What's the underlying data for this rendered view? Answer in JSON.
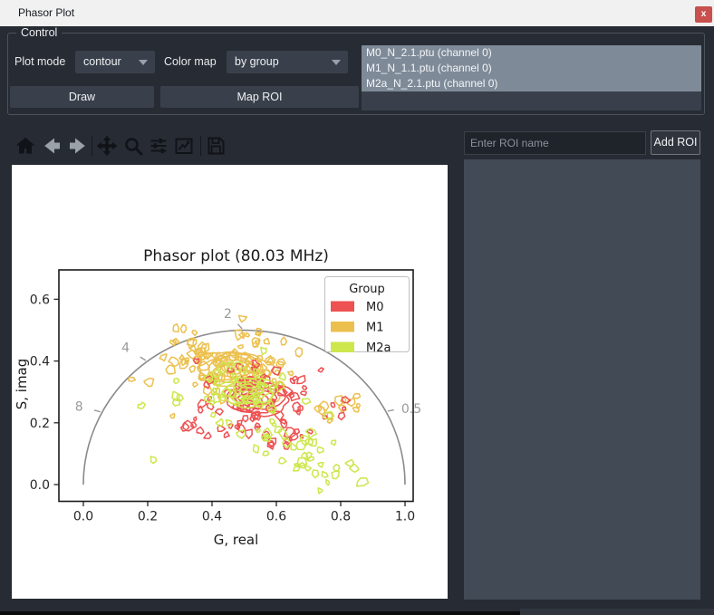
{
  "window": {
    "title": "Phasor Plot",
    "close_label": "x"
  },
  "control": {
    "group_label": "Control",
    "plot_mode_label": "Plot mode",
    "plot_mode_value": "contour",
    "color_map_label": "Color map",
    "color_map_value": "by group",
    "draw_label": "Draw",
    "map_roi_label": "Map ROI",
    "files": [
      "M0_N_2.1.ptu (channel 0)",
      "M1_N_1.1.ptu (channel 0)",
      "M2a_N_2.1.ptu (channel 0)"
    ]
  },
  "toolbar": {
    "icons": [
      {
        "name": "home",
        "enabled": true
      },
      {
        "name": "back",
        "enabled": false
      },
      {
        "name": "forward",
        "enabled": false
      },
      {
        "name": "pan",
        "enabled": true
      },
      {
        "name": "zoom",
        "enabled": true
      },
      {
        "name": "subplots",
        "enabled": true
      },
      {
        "name": "customize",
        "enabled": true
      },
      {
        "name": "save",
        "enabled": true
      }
    ]
  },
  "roi": {
    "input_placeholder": "Enter ROI name",
    "add_button_label": "Add ROI"
  },
  "chart_data": {
    "type": "contour",
    "title": "Phasor plot (80.03 MHz)",
    "frequency_mhz": 80.03,
    "xlabel": "G, real",
    "ylabel": "S, imag",
    "xlim": [
      -0.08,
      1.03
    ],
    "ylim": [
      -0.05,
      0.7
    ],
    "xticks": [
      0.0,
      0.2,
      0.4,
      0.6,
      0.8,
      1.0
    ],
    "yticks": [
      0.0,
      0.2,
      0.4,
      0.6
    ],
    "grid": false,
    "universal_semicircle": {
      "center_g": 0.5,
      "radius": 0.5,
      "color": "#8a8a8a",
      "lifetime_labels": [
        {
          "text": "0.5",
          "tau_ns": 0.5,
          "g": 0.9405,
          "s": 0.2365,
          "offset": [
            10,
            -2
          ],
          "anchor": "start"
        },
        {
          "text": "2",
          "tau_ns": 2,
          "g": 0.4972,
          "s": 0.5,
          "offset": [
            -10,
            -11
          ],
          "anchor": "middle"
        },
        {
          "text": "4",
          "tau_ns": 4,
          "g": 0.1983,
          "s": 0.3989,
          "offset": [
            -14,
            -9
          ],
          "anchor": "middle"
        },
        {
          "text": "8",
          "tau_ns": 8,
          "g": 0.0582,
          "s": 0.2341,
          "offset": [
            -15,
            -4
          ],
          "anchor": "middle"
        }
      ]
    },
    "legend": {
      "title": "Group",
      "position": "upper right",
      "entries": [
        {
          "label": "M0",
          "color": "#ee5152"
        },
        {
          "label": "M1",
          "color": "#ecc04f"
        },
        {
          "label": "M2a",
          "color": "#cde74d"
        }
      ]
    },
    "draw_order": [
      "M1",
      "M0",
      "M2a"
    ],
    "groups": [
      {
        "name": "M0",
        "color": "#ee5152",
        "seed": 7,
        "core": {
          "center": [
            0.545,
            0.275
          ],
          "rx": 0.095,
          "ry": 0.05,
          "ring_scales": [
            0.35,
            0.6,
            0.8,
            1.0
          ],
          "scatter": {
            "sigma": [
              0.09,
              0.05
            ],
            "count": 50
          }
        },
        "satellites": [
          {
            "center": [
              0.42,
              0.2
            ],
            "sigma": [
              0.06,
              0.04
            ],
            "count": 16
          },
          {
            "center": [
              0.62,
              0.16
            ],
            "sigma": [
              0.06,
              0.03
            ],
            "count": 12
          },
          {
            "center": [
              0.52,
              0.33
            ],
            "sigma": [
              0.1,
              0.04
            ],
            "count": 14
          },
          {
            "center": [
              0.78,
              0.24
            ],
            "sigma": [
              0.04,
              0.03
            ],
            "count": 5
          }
        ]
      },
      {
        "name": "M1",
        "color": "#ecc04f",
        "seed": 13,
        "core": {
          "center": [
            0.465,
            0.375
          ],
          "rx": 0.115,
          "ry": 0.055,
          "ring_scales": [
            0.3,
            0.5,
            0.7,
            0.85,
            1.0
          ],
          "scatter": {
            "sigma": [
              0.1,
              0.045
            ],
            "count": 60
          }
        },
        "satellites": [
          {
            "center": [
              0.36,
              0.43
            ],
            "sigma": [
              0.05,
              0.035
            ],
            "count": 22
          },
          {
            "center": [
              0.6,
              0.36
            ],
            "sigma": [
              0.07,
              0.04
            ],
            "count": 18
          },
          {
            "center": [
              0.78,
              0.23
            ],
            "sigma": [
              0.05,
              0.04
            ],
            "count": 12
          },
          {
            "center": [
              0.52,
              0.49
            ],
            "sigma": [
              0.06,
              0.02
            ],
            "count": 10
          }
        ]
      },
      {
        "name": "M2a",
        "color": "#cde74d",
        "seed": 29,
        "core": {
          "center": [
            0.51,
            0.3
          ],
          "rx": 0.09,
          "ry": 0.048,
          "ring_scales": [
            0.3,
            0.5,
            0.7,
            0.85,
            1.0
          ],
          "scatter": {
            "sigma": [
              0.085,
              0.05
            ],
            "count": 45
          }
        },
        "satellites": [
          {
            "center": [
              0.7,
              0.1
            ],
            "sigma": [
              0.07,
              0.045
            ],
            "count": 20
          },
          {
            "center": [
              0.56,
              0.16
            ],
            "sigma": [
              0.06,
              0.03
            ],
            "count": 12
          },
          {
            "center": [
              0.8,
              0.05
            ],
            "sigma": [
              0.05,
              0.03
            ],
            "count": 8
          },
          {
            "center": [
              0.18,
              0.25
            ],
            "sigma": [
              0.004,
              0.004
            ],
            "count": 1
          },
          {
            "center": [
              0.22,
              0.08
            ],
            "sigma": [
              0.004,
              0.004
            ],
            "count": 1
          },
          {
            "center": [
              0.3,
              0.27
            ],
            "sigma": [
              0.012,
              0.009
            ],
            "count": 2
          }
        ]
      }
    ]
  }
}
